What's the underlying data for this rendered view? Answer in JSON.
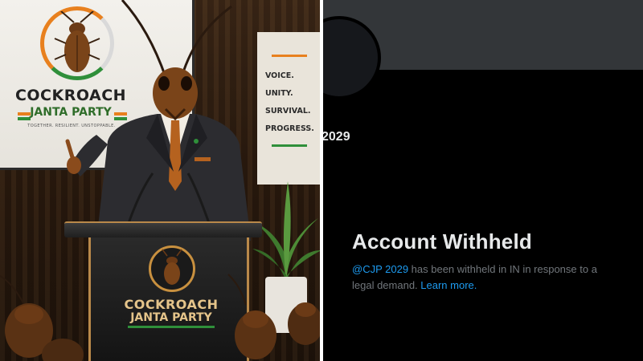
{
  "left_panel": {
    "screen": {
      "title": "COCKROACH",
      "subtitle": "JANTA PARTY",
      "tagline": "TOGETHER. RESILIENT. UNSTOPPABLE."
    },
    "banner": {
      "lines": [
        "VOICE.",
        "UNITY.",
        "SURVIVAL.",
        "PROGRESS."
      ]
    },
    "podium": {
      "title": "COCKROACH",
      "subtitle": "JANTA PARTY"
    }
  },
  "right_panel": {
    "handle_fragment": "2029",
    "withheld": {
      "title": "Account Withheld",
      "handle": "@CJP 2029",
      "message": " has been withheld in IN in response to a legal demand. ",
      "learn_more": "Learn more."
    }
  },
  "colors": {
    "saffron": "#e8801e",
    "green": "#2f8f3a",
    "x_link_blue": "#1d9bf0",
    "x_text_primary": "#e7e9ea",
    "x_text_secondary": "#71767b",
    "x_header_gray": "#333639"
  }
}
